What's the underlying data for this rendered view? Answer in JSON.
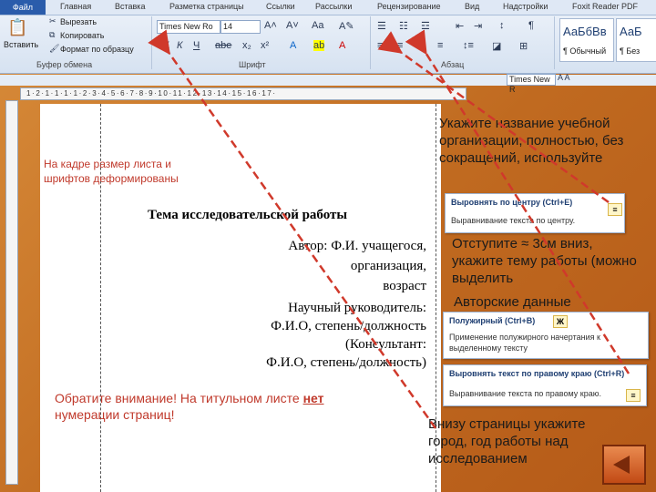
{
  "ribbon": {
    "file_tab": "Файл",
    "tabs": [
      "Главная",
      "Вставка",
      "Разметка страницы",
      "Ссылки",
      "Рассылки",
      "Рецензирование",
      "Вид",
      "Надстройки",
      "Foxit Reader PDF"
    ],
    "clipboard": {
      "paste": "Вставить",
      "cut": "Вырезать",
      "copy": "Копировать",
      "format_painter": "Формат по образцу",
      "group_label": "Буфер обмена"
    },
    "font": {
      "font_name": "Times New Ro",
      "font_size": "14",
      "group_label": "Шрифт"
    },
    "paragraph": {
      "group_label": "Абзац"
    },
    "styles": {
      "sample1": "АаБбВв",
      "sample2": "АаБ",
      "style1": "¶ Обычный",
      "style2": "¶ Без"
    }
  },
  "mini_toolbar": {
    "font_name": "Times New R"
  },
  "page": {
    "note_deformed": "На кадре размер листа и шрифтов деформированы",
    "title": "Тема исследовательской работы",
    "author_line1": "Автор: Ф.И. учащегося,",
    "author_line2": "организация,",
    "author_line3": "возраст",
    "supervisor_line1": "Научный руководитель:",
    "supervisor_line2": "Ф.И.О, степень/должность",
    "consultant_line1": "(Консультант:",
    "consultant_line2": "Ф.И.О, степень/должность)",
    "note_pages_prefix": "Обратите внимание! На титульном листе ",
    "note_pages_net": "нет",
    "note_pages_suffix": " нумерации страниц!"
  },
  "hints": {
    "org": "Укажите название учебной организации, полностью, без сокращений, используйте",
    "indent": "Отступите ≈ 3см вниз, укажите тему работы (можно выделить",
    "authors": "Авторские данные",
    "bottom": "Внизу страницы укажите город, год работы над исследованием"
  },
  "tips": {
    "center_title": "Выровнять по центру (Ctrl+E)",
    "center_desc": "Выравнивание текста по центру.",
    "bold_title": "Полужирный (Ctrl+B)",
    "bold_icon": "Ж",
    "bold_desc1": "Применение полужирного начертания к",
    "bold_desc2": "выделенному тексту",
    "right_title": "Выровнять текст по правому краю (Ctrl+R)",
    "right_desc": "Выравнивание текста по правому краю."
  },
  "colors": {
    "accent_red": "#c0392b",
    "arrow_red": "#d0392b",
    "background": "#c9772a"
  },
  "icons": [
    "paste-icon",
    "cut-icon",
    "copy-icon",
    "format-painter-icon",
    "bold-icon",
    "align-center-icon",
    "align-right-icon",
    "back-arrow-icon"
  ]
}
